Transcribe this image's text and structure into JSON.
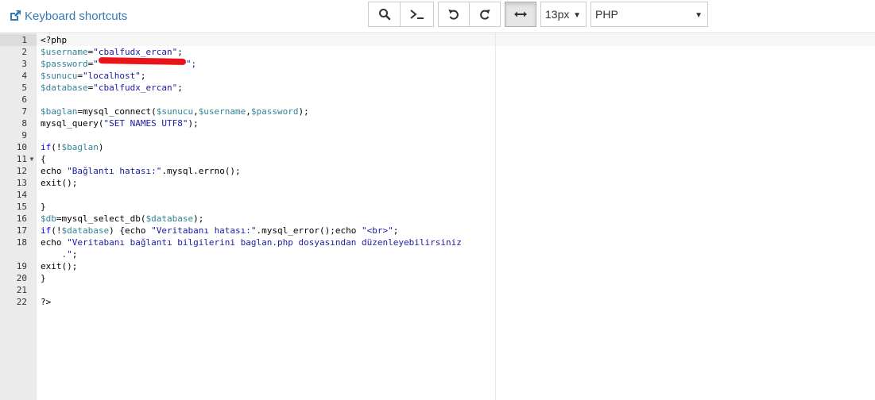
{
  "toolbar": {
    "keyboard_shortcuts": "Keyboard shortcuts",
    "font_size": "13px",
    "mode": "PHP",
    "icons": [
      "search-icon",
      "terminal-icon",
      "undo-icon",
      "redo-icon",
      "wrap-icon"
    ]
  },
  "editor": {
    "line_numbers": [
      "1",
      "2",
      "3",
      "4",
      "5",
      "6",
      "7",
      "8",
      "9",
      "10",
      "11",
      "12",
      "13",
      "14",
      "15",
      "16",
      "17",
      "18",
      "19",
      "20",
      "21",
      "22"
    ],
    "lines": {
      "l1": "<?php",
      "l2a": "$username",
      "l2b": "=",
      "l2c": "\"cbalfudx_ercan\"",
      "l2d": ";",
      "l3a": "$password",
      "l3b": "=",
      "l3c": "\"",
      "l3d": "\";",
      "l4a": "$sunucu",
      "l4b": "=",
      "l4c": "\"localhost\"",
      "l4d": ";",
      "l5a": "$database",
      "l5b": "=",
      "l5c": "\"cbalfudx_ercan\"",
      "l5d": ";",
      "l7a": "$baglan",
      "l7b": "=mysql_connect(",
      "l7c": "$sunucu",
      "l7d": ",",
      "l7e": "$username",
      "l7f": ",",
      "l7g": "$password",
      "l7h": ");",
      "l8a": "mysql_query(",
      "l8b": "\"SET NAMES UTF8\"",
      "l8c": ");",
      "l10a": "if",
      "l10b": "(!",
      "l10c": "$baglan",
      "l10d": ")",
      "l11": "{",
      "l12a": "echo ",
      "l12b": "\"Bağlantı hatası:\"",
      "l12c": ".mysql.errno();",
      "l13": "exit();",
      "l15": "}",
      "l16a": "$db",
      "l16b": "=mysql_select_db(",
      "l16c": "$database",
      "l16d": ");",
      "l17a": "if",
      "l17b": "(!",
      "l17c": "$database",
      "l17d": ") {echo ",
      "l17e": "\"Veritabanı hatası:\"",
      "l17f": ".mysql_error();echo ",
      "l17g": "\"<br>\"",
      "l17h": ";",
      "l18a": "echo ",
      "l18b": "\"Veritabanı bağlantı bilgilerini baglan.php dosyasından düzenleyebilirsiniz",
      "l18c": "    .\"",
      "l18d": ";",
      "l19": "exit();",
      "l20": "}",
      "l22": "?>"
    }
  },
  "colors": {
    "variable": "#318495",
    "string": "#1a1aa6",
    "keyword": "#0000ff",
    "link": "#337ab7",
    "redaction": "#e8141a"
  }
}
